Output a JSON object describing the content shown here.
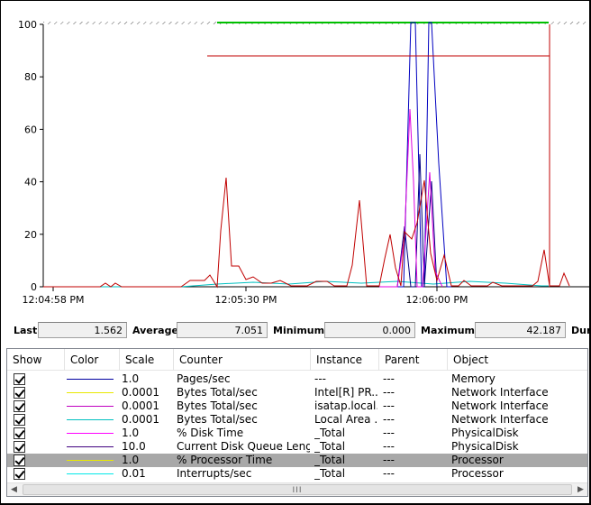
{
  "chart": {
    "y_ticks": [
      "100",
      "80",
      "60",
      "40",
      "20",
      "0"
    ],
    "x_ticks": [
      "12:04:58 PM",
      "12:05:30 PM",
      "12:06:00 PM"
    ]
  },
  "stats": {
    "last_label": "Last",
    "last_value": "1.562",
    "average_label": "Average",
    "average_value": "7.051",
    "minimum_label": "Minimum",
    "minimum_value": "0.000",
    "maximum_label": "Maximum",
    "maximum_value": "42.187",
    "duration_label": "Dur"
  },
  "table": {
    "columns": [
      "Show",
      "Color",
      "Scale",
      "Counter",
      "Instance",
      "Parent",
      "Object"
    ],
    "rows": [
      {
        "color": "#0000a0",
        "scale": "1.0",
        "counter": "Pages/sec",
        "instance": "---",
        "parent": "---",
        "object": "Memory"
      },
      {
        "color": "#e8e800",
        "scale": "0.0001",
        "counter": "Bytes Total/sec",
        "instance": "Intel[R] PR...",
        "parent": "---",
        "object": "Network Interface"
      },
      {
        "color": "#c000c0",
        "scale": "0.0001",
        "counter": "Bytes Total/sec",
        "instance": "isatap.local...",
        "parent": "---",
        "object": "Network Interface"
      },
      {
        "color": "#00c0c0",
        "scale": "0.0001",
        "counter": "Bytes Total/sec",
        "instance": "Local Area ...",
        "parent": "---",
        "object": "Network Interface"
      },
      {
        "color": "#ff00ff",
        "scale": "1.0",
        "counter": "% Disk Time",
        "instance": "_Total",
        "parent": "---",
        "object": "PhysicalDisk"
      },
      {
        "color": "#400080",
        "scale": "10.0",
        "counter": "Current Disk Queue Length",
        "instance": "_Total",
        "parent": "---",
        "object": "PhysicalDisk"
      },
      {
        "color": "#e8e800",
        "scale": "1.0",
        "counter": "% Processor Time",
        "instance": "_Total",
        "parent": "---",
        "object": "Processor",
        "selected": true
      },
      {
        "color": "#00e8e8",
        "scale": "0.01",
        "counter": "Interrupts/sec",
        "instance": "_Total",
        "parent": "---",
        "object": "Processor"
      }
    ]
  },
  "colors": {
    "red_series": "#c00000",
    "blue_series": "#0000c0",
    "green_top": "#00c000"
  }
}
